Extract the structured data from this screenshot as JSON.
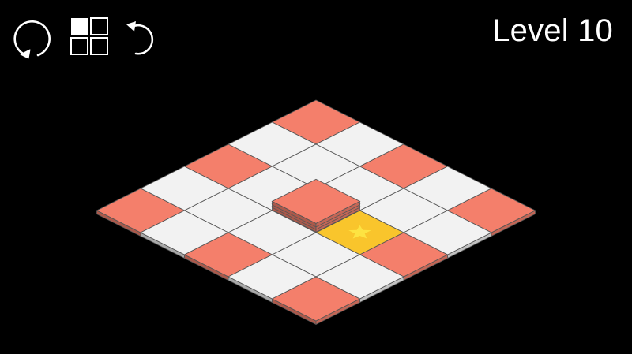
{
  "hud": {
    "level_label": "Level 10",
    "restart_icon": "restart-icon",
    "levels_icon": "level-select-grid-icon",
    "undo_icon": "undo-icon"
  },
  "colors": {
    "background": "#000000",
    "tile_empty": "#f2f2f2",
    "tile_red": "#f47f6b",
    "tile_goal": "#f9c52c",
    "goal_star": "#fde342",
    "tile_edge": "#555555",
    "hud": "#ffffff"
  },
  "board": {
    "rows": 5,
    "cols": 5,
    "cells": [
      [
        "red",
        "empty",
        "red",
        "empty",
        "red"
      ],
      [
        "empty",
        "empty",
        "empty",
        "empty",
        "empty"
      ],
      [
        "red",
        "empty",
        "red",
        "goal",
        "red"
      ],
      [
        "empty",
        "empty",
        "empty",
        "empty",
        "empty"
      ],
      [
        "red",
        "empty",
        "red",
        "empty",
        "red"
      ]
    ],
    "stacks": [
      {
        "row": 2,
        "col": 2,
        "height": 4
      }
    ],
    "goal_icon": "star-icon"
  }
}
